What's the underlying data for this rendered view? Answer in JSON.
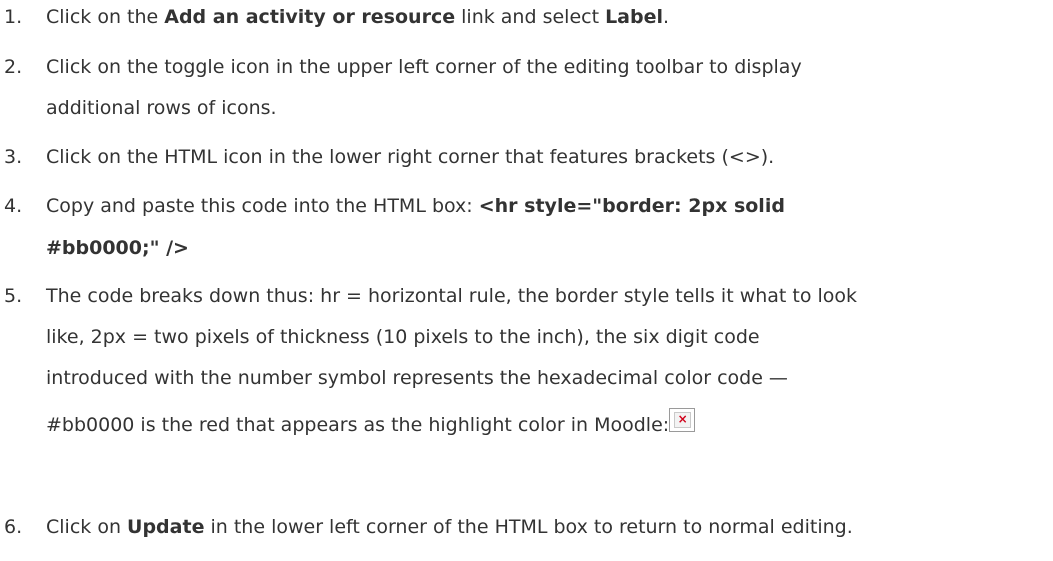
{
  "steps": [
    {
      "number": "1.",
      "line1": {
        "t1": "Click on the ",
        "b1": "Add an activity or resource",
        "t2": " link and select ",
        "b2": "Label",
        "t3": "."
      }
    },
    {
      "number": "2.",
      "line1": "Click on the toggle icon in the upper left corner of the editing toolbar to display",
      "line2": "additional rows of icons."
    },
    {
      "number": "3.",
      "line1": "Click on the HTML icon in the lower right corner that features brackets (<>)."
    },
    {
      "number": "4.",
      "line1": {
        "t1": "Copy and paste this code into the HTML box: ",
        "b1": "<hr style=\"border: 2px solid"
      },
      "line2": "#bb0000;\" />"
    },
    {
      "number": "5.",
      "line1": "The code breaks down thus: hr = horizontal rule, the border style tells it what to look",
      "line2": "like, 2px = two pixels of thickness (10 pixels to the inch), the six digit code",
      "line3": "introduced with the number symbol represents the hexadecimal color code —",
      "line4": "#bb0000 is the red that appears as the highlight color in Moodle:"
    },
    {
      "number": "6.",
      "line1": {
        "t1": "Click on ",
        "b1": "Update",
        "t2": " in the lower left corner of the HTML box to return to normal editing."
      }
    }
  ],
  "broken_image_icon": "broken-image-icon",
  "broken_image_glyph": "×"
}
